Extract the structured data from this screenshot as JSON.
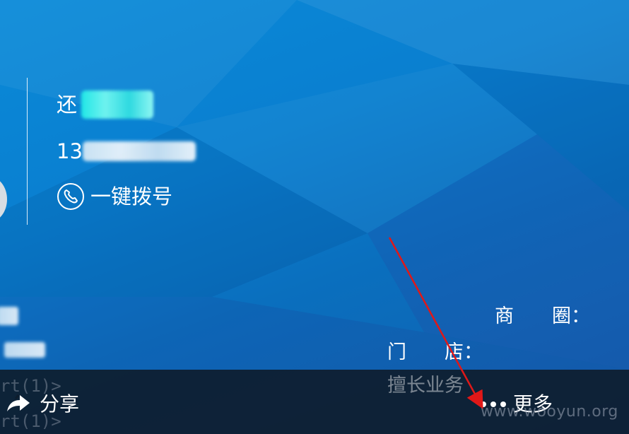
{
  "contact": {
    "name_prefix": "还",
    "phone_prefix": "13",
    "dial_label": "一键拨号"
  },
  "fields": {
    "business_area_label": "商　　圈：",
    "store_label": "门　　店：",
    "specialty_label": "擅长业务"
  },
  "ghost_code": {
    "line1": "rt(1)>",
    "line2": "rt(1)>"
  },
  "bottom_bar": {
    "share_label": "分享",
    "more_label": "更多"
  },
  "watermark": "www.wooyun.org",
  "colors": {
    "background": "#0a7fd0",
    "bottom_bar": "#0e1c2c",
    "text": "#ffffff",
    "name_highlight": "#20e6e6",
    "annotation_arrow": "#e01818"
  },
  "icons": {
    "dial": "phone-circle-icon",
    "share": "share-arrow-icon",
    "more": "more-dots-icon"
  }
}
